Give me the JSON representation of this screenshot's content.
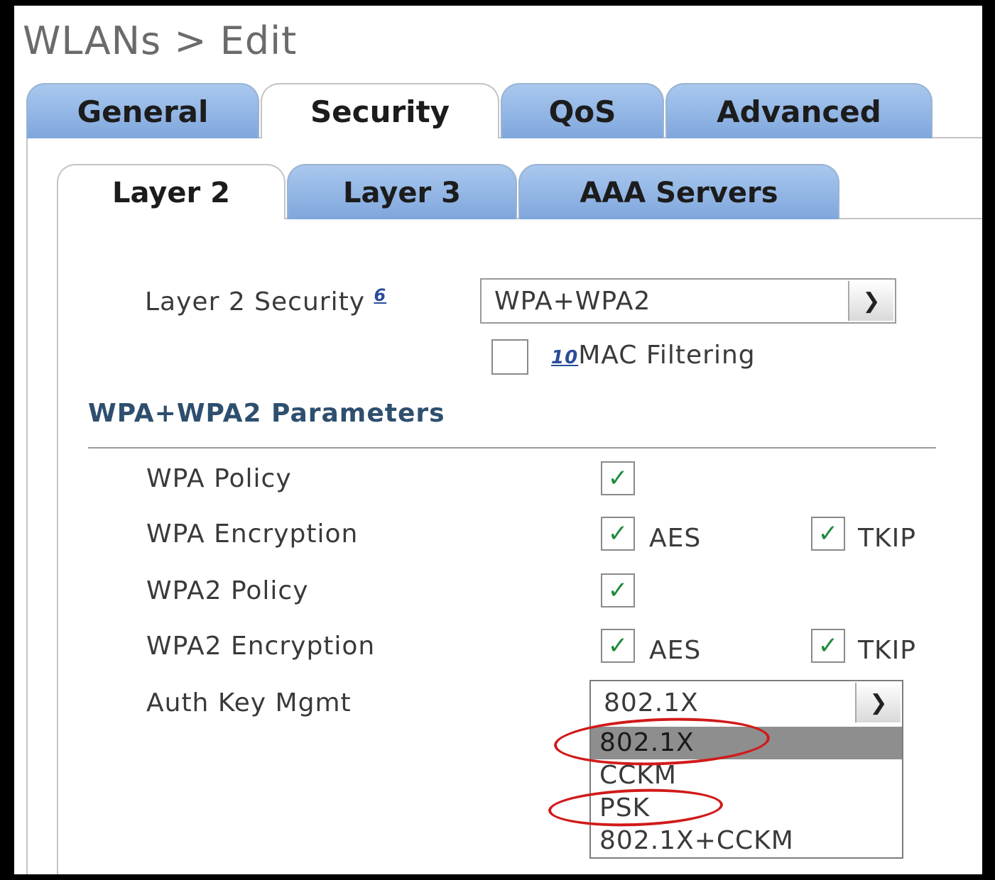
{
  "page": {
    "title": "WLANs > Edit"
  },
  "main_tabs": [
    {
      "label": "General",
      "active": false
    },
    {
      "label": "Security",
      "active": true
    },
    {
      "label": "QoS",
      "active": false
    },
    {
      "label": "Advanced",
      "active": false
    }
  ],
  "sub_tabs": [
    {
      "label": "Layer 2",
      "active": true
    },
    {
      "label": "Layer 3",
      "active": false
    },
    {
      "label": "AAA Servers",
      "active": false
    }
  ],
  "layer2_security": {
    "label": "Layer 2 Security",
    "footnote": "6",
    "value": "WPA+WPA2"
  },
  "mac_filtering": {
    "footnote": "10",
    "label": "MAC Filtering",
    "checked": false
  },
  "section": {
    "heading": "WPA+WPA2 Parameters"
  },
  "wpa_policy": {
    "label": "WPA Policy",
    "checked": true
  },
  "wpa_encryption": {
    "label": "WPA Encryption",
    "aes": {
      "label": "AES",
      "checked": true
    },
    "tkip": {
      "label": "TKIP",
      "checked": true
    }
  },
  "wpa2_policy": {
    "label": "WPA2 Policy",
    "checked": true
  },
  "wpa2_encryption": {
    "label": "WPA2 Encryption",
    "aes": {
      "label": "AES",
      "checked": true
    },
    "tkip": {
      "label": "TKIP",
      "checked": true
    }
  },
  "auth_key_mgmt": {
    "label": "Auth Key Mgmt",
    "value": "802.1X",
    "options": [
      "802.1X",
      "CCKM",
      "PSK",
      "802.1X+CCKM"
    ],
    "highlighted_option": "802.1X",
    "circled_options": [
      "802.1X",
      "PSK"
    ]
  },
  "colors": {
    "tab_blue": "#8fb3e6",
    "check_green": "#1f8a3a",
    "heading_blue": "#2e4f6e",
    "annotation_red": "#d11a1a"
  }
}
